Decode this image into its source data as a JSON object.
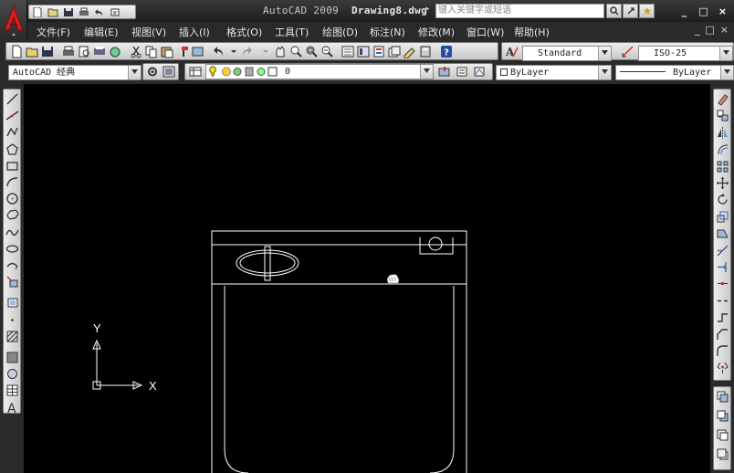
{
  "window": {
    "app_name": "AutoCAD 2009",
    "file_name": "Drawing8.dwg",
    "help_placeholder": "键入关键字或短语",
    "controls": [
      "_",
      "□",
      "×"
    ]
  },
  "menu": {
    "items": [
      "文件(F)",
      "编辑(E)",
      "视图(V)",
      "插入(I)",
      "格式(O)",
      "工具(T)",
      "绘图(D)",
      "标注(N)",
      "修改(M)",
      "窗口(W)",
      "帮助(H)"
    ],
    "doc_controls": [
      "_",
      "□",
      "×"
    ]
  },
  "toolbar1": {
    "text_style": "Standard",
    "dim_style": "ISO-25"
  },
  "toolbar2": {
    "workspace": "AutoCAD 经典",
    "layer": "0",
    "color": "ByLayer",
    "linetype": "ByLayer"
  },
  "ucs": {
    "x_label": "X",
    "y_label": "Y"
  },
  "colors": {
    "canvas": "#000000",
    "line": "#ffffff",
    "brand_red": "#cc1a1a"
  },
  "left_tools": [
    "line-icon",
    "construction-line-icon",
    "polyline-icon",
    "polygon-icon",
    "rectangle-icon",
    "arc-icon",
    "circle-icon",
    "revision-cloud-icon",
    "spline-icon",
    "ellipse-icon",
    "ellipse-arc-icon",
    "insert-block-icon",
    "make-block-icon",
    "point-icon",
    "hatch-icon",
    "gradient-icon",
    "region-icon",
    "table-icon",
    "multiline-text-icon"
  ],
  "right_tools": [
    "erase-icon",
    "copy-icon",
    "mirror-icon",
    "offset-icon",
    "array-icon",
    "move-icon",
    "rotate-icon",
    "scale-icon",
    "stretch-icon",
    "trim-icon",
    "extend-icon",
    "break-at-point-icon",
    "break-icon",
    "join-icon",
    "chamfer-icon",
    "fillet-icon",
    "explode-icon"
  ],
  "right_tools2": [
    "draworder-front-icon",
    "draworder-back-icon",
    "bring-above-icon",
    "send-under-icon"
  ]
}
